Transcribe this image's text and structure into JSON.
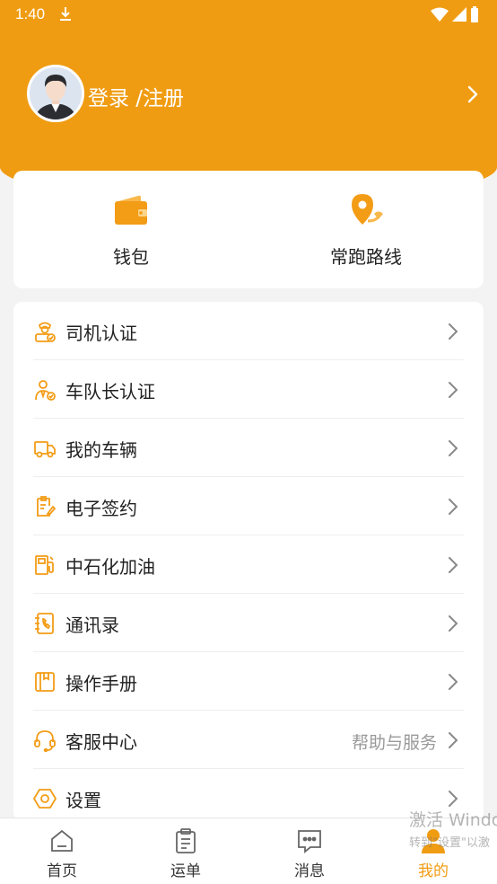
{
  "status_bar": {
    "time": "1:40",
    "download_icon": "download-icon",
    "wifi_icon": "wifi-icon",
    "signal_icon": "signal-icon",
    "battery_icon": "battery-icon"
  },
  "profile": {
    "login_label": "登录 /注册",
    "avatar_icon": "avatar"
  },
  "quick_actions": [
    {
      "label": "钱包",
      "icon": "wallet-icon"
    },
    {
      "label": "常跑路线",
      "icon": "route-pin-icon"
    }
  ],
  "menu": {
    "items": [
      {
        "label": "司机认证",
        "icon": "driver-icon",
        "hint": ""
      },
      {
        "label": "车队长认证",
        "icon": "captain-icon",
        "hint": ""
      },
      {
        "label": "我的车辆",
        "icon": "truck-icon",
        "hint": ""
      },
      {
        "label": "电子签约",
        "icon": "contract-icon",
        "hint": ""
      },
      {
        "label": "中石化加油",
        "icon": "fuel-icon",
        "hint": ""
      },
      {
        "label": "通讯录",
        "icon": "contacts-icon",
        "hint": ""
      },
      {
        "label": "操作手册",
        "icon": "manual-icon",
        "hint": ""
      },
      {
        "label": "客服中心",
        "icon": "headset-icon",
        "hint": "帮助与服务"
      },
      {
        "label": "设置",
        "icon": "settings-icon",
        "hint": ""
      }
    ]
  },
  "tabs": [
    {
      "label": "首页",
      "icon": "home-icon",
      "active": false
    },
    {
      "label": "运单",
      "icon": "waybill-icon",
      "active": false
    },
    {
      "label": "消息",
      "icon": "message-icon",
      "active": false
    },
    {
      "label": "我的",
      "icon": "profile-icon",
      "active": true
    }
  ],
  "watermark": {
    "line1": "激活 Windo",
    "line2": "转到\"设置\"以激"
  },
  "colors": {
    "accent": "#f09c12",
    "background": "#f3f3f3",
    "card": "#ffffff",
    "text": "#222222",
    "hint": "#999999"
  }
}
